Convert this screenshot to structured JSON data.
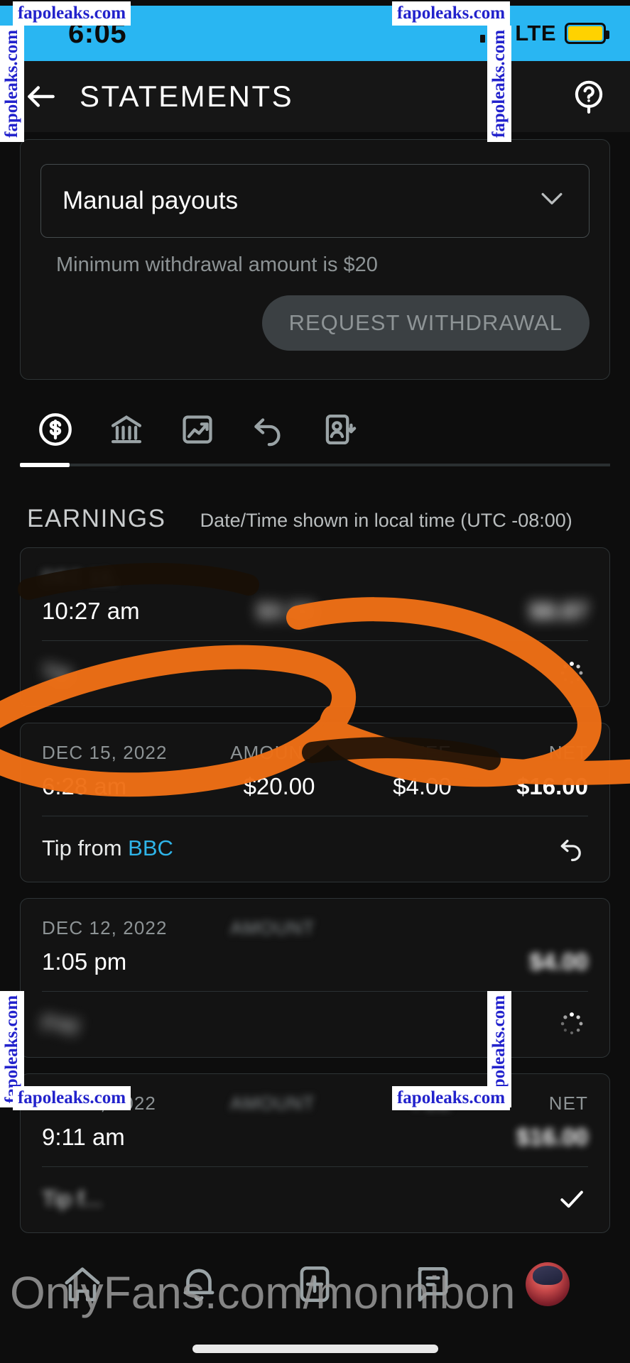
{
  "statusbar": {
    "time": "6:05",
    "network": "LTE",
    "signal_icon": "signal-bars-icon",
    "battery_icon": "battery-icon",
    "battery_color": "#ffd200",
    "bar_color": "#29b6f2"
  },
  "appbar": {
    "back_icon": "back-arrow-icon",
    "title": "STATEMENTS",
    "help_icon": "help-circle-icon"
  },
  "withdraw": {
    "payout_mode": "Manual payouts",
    "dropdown_icon": "chevron-down-icon",
    "helper_text": "Minimum withdrawal amount is $20",
    "request_button": "REQUEST WITHDRAWAL",
    "request_button_enabled": false
  },
  "tabs": [
    {
      "name": "tab-earnings",
      "icon": "dollar-circle-icon",
      "active": true
    },
    {
      "name": "tab-payouts",
      "icon": "bank-icon",
      "active": false
    },
    {
      "name": "tab-statistics",
      "icon": "chart-image-icon",
      "active": false
    },
    {
      "name": "tab-refunds",
      "icon": "undo-arrow-icon",
      "active": false
    },
    {
      "name": "tab-subscribers",
      "icon": "person-card-icon",
      "active": false
    }
  ],
  "earnings": {
    "section_title": "EARNINGS",
    "timezone_note": "Date/Time shown in local time (UTC -08:00)",
    "columns": [
      "AMOUNT",
      "FEE",
      "NET"
    ]
  },
  "transactions": [
    {
      "date": "DEC 10,",
      "time": "10:27 am",
      "amount_label": "",
      "amount": "$8.56",
      "fee_label": "",
      "fee": "",
      "net_label": "",
      "net": "$8.87",
      "description": "Tip",
      "action_icon": "loading-spinner-icon",
      "obscured": true,
      "highlighted": false
    },
    {
      "date": "DEC 15, 2022",
      "time": "6:28 am",
      "amount_label": "AMOUNT",
      "amount": "$20.00",
      "fee_label": "FEE",
      "fee": "$4.00",
      "net_label": "NET",
      "net": "$16.00",
      "description_prefix": "Tip from ",
      "description_link": "BBC",
      "action_icon": "undo-arrow-icon",
      "obscured": false,
      "highlighted": true
    },
    {
      "date": "DEC 12, 2022",
      "time": "1:05 pm",
      "amount_label": "AMOUNT",
      "amount": "",
      "fee_label": "",
      "fee": "",
      "net_label": "",
      "net": "$4.00",
      "description": "Pay",
      "action_icon": "loading-spinner-icon",
      "obscured": true,
      "highlighted": false
    },
    {
      "date": "DEC 8, 2022",
      "time": "9:11 am",
      "amount_label": "AMOUNT",
      "amount": "",
      "fee_label": "FEE",
      "fee": "",
      "net_label": "NET",
      "net": "$16.00",
      "description": "Tip f...",
      "action_icon": "check-icon",
      "obscured": true,
      "highlighted": false
    }
  ],
  "bottomnav": [
    {
      "name": "nav-home",
      "icon": "home-icon"
    },
    {
      "name": "nav-notifications",
      "icon": "bell-icon"
    },
    {
      "name": "nav-add-post",
      "icon": "plus-square-icon"
    },
    {
      "name": "nav-messages",
      "icon": "message-icon"
    },
    {
      "name": "nav-profile",
      "icon": "avatar-icon"
    }
  ],
  "annotation": {
    "color": "#ee6f16",
    "shape": "hand-drawn-circles"
  },
  "watermarks": {
    "site": "fapoleaks.com",
    "overlay": "OnlyFans.com/monnibon"
  }
}
